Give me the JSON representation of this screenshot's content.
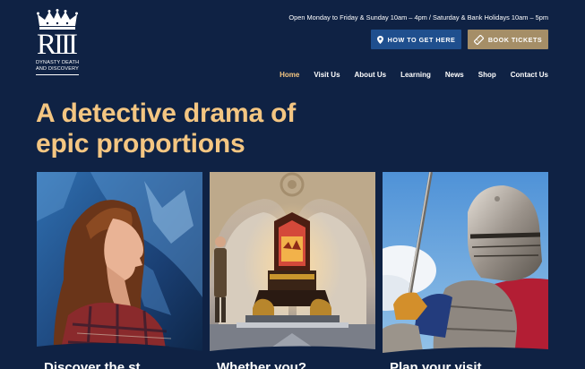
{
  "logo": {
    "monogram": "RIII",
    "line1": "Dynasty Death",
    "line2": "and Discovery"
  },
  "header": {
    "hours": "Open Monday to Friday & Sunday 10am – 4pm / Saturday & Bank Holidays 10am – 5pm",
    "directions_label": "HOW TO GET HERE",
    "tickets_label": "BOOK TICKETS"
  },
  "nav": [
    "Home",
    "Visit Us",
    "About Us",
    "Learning",
    "News",
    "Shop",
    "Contact Us"
  ],
  "nav_active": "Home",
  "hero": {
    "line1": "A detective drama of",
    "line2": "epic proportions"
  },
  "cards": [
    {
      "label": "Discover the st"
    },
    {
      "label": "Whether you?"
    },
    {
      "label": "Plan your visit"
    }
  ],
  "colors": {
    "background": "#0f2244",
    "accent": "#f4c682",
    "directions_button": "#1f4f8e",
    "tickets_button": "#a58e67"
  },
  "icons": {
    "crown": "crown-icon",
    "location": "map-pin-icon",
    "ticket": "ticket-icon"
  }
}
